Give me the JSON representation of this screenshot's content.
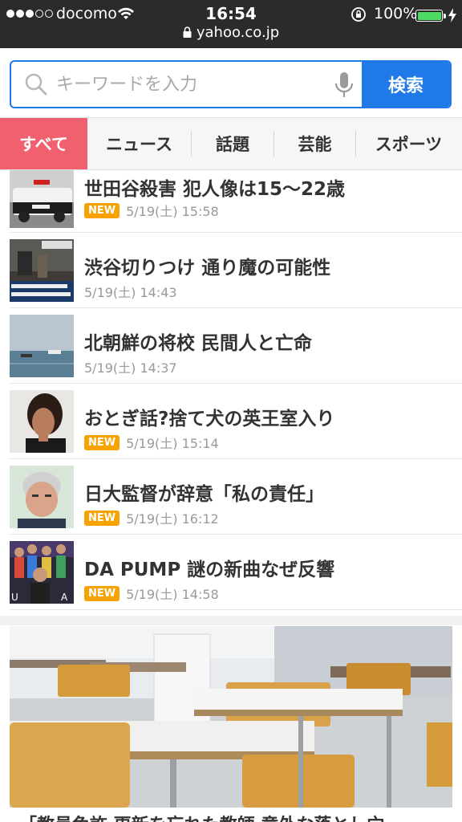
{
  "status_bar": {
    "carrier": "docomo",
    "time": "16:54",
    "battery_percent": "100%",
    "url": "yahoo.co.jp"
  },
  "search": {
    "placeholder": "キーワードを入力",
    "button_label": "検索"
  },
  "tabs": [
    {
      "label": "すべて",
      "active": true
    },
    {
      "label": "ニュース"
    },
    {
      "label": "話題"
    },
    {
      "label": "芸能"
    },
    {
      "label": "スポーツ"
    }
  ],
  "news": [
    {
      "title": "世田谷殺害 犯人像は15〜22歳",
      "new": true,
      "date": "5/19(土) 15:58"
    },
    {
      "title": "渋谷切りつけ 通り魔の可能性",
      "new": false,
      "date": "5/19(土) 14:43"
    },
    {
      "title": "北朝鮮の将校 民間人と亡命",
      "new": false,
      "date": "5/19(土) 14:37"
    },
    {
      "title": "おとぎ話?捨て犬の英王室入り",
      "new": true,
      "date": "5/19(土) 15:14"
    },
    {
      "title": "日大監督が辞意「私の責任」",
      "new": true,
      "date": "5/19(土) 16:12"
    },
    {
      "title": "DA PUMP 謎の新曲なぜ反響",
      "new": true,
      "date": "5/19(土) 14:58"
    }
  ],
  "badge_label": "NEW",
  "feature_caption": "「教員免許 更新を忘れた教師 意外な落とし穴",
  "colors": {
    "accent": "#1f7ae8",
    "tab_active": "#f0606e",
    "badge": "#f7a200"
  }
}
